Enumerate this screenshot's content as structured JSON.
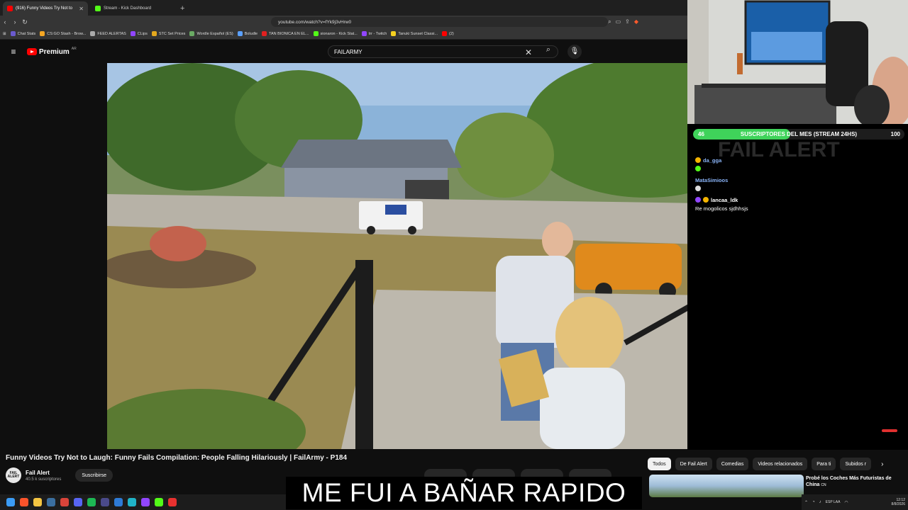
{
  "browser": {
    "tabs": [
      {
        "label": "(916) Funny Videos Try Not to",
        "active": true,
        "color": "#ff0000"
      },
      {
        "label": "Stream - Kick Dashboard",
        "active": false,
        "color": "#53fc18"
      }
    ],
    "new_tab": "+",
    "url": "youtube.com/watch?v=fYk9j3vHrw0",
    "bookmarks": [
      {
        "label": "Chat Stats",
        "color": "#6a5acd"
      },
      {
        "label": "CS:GO Stash - Brow...",
        "color": "#f5a623"
      },
      {
        "label": "FEED ALERTAS",
        "color": "#aaaaaa"
      },
      {
        "label": "CLips",
        "color": "#9146ff"
      },
      {
        "label": "STC Set Prices",
        "color": "#e4a81e"
      },
      {
        "label": "Wordle Español (ES)",
        "color": "#6aaa64"
      },
      {
        "label": "Boludle",
        "color": "#5aa0ff"
      },
      {
        "label": "TAN BIONICA EN EL...",
        "color": "#e02020"
      },
      {
        "label": "sionaron - Kick Stat...",
        "color": "#53fc18"
      },
      {
        "label": "trr - Twitch",
        "color": "#9146ff"
      },
      {
        "label": "Tanuki Sunset Classi...",
        "color": "#f5d020"
      },
      {
        "label": "(2)",
        "color": "#ff0000"
      }
    ]
  },
  "youtube": {
    "logo": "Premium",
    "region": "AR",
    "search_value": "FAILARMY",
    "video_title": "Funny Videos Try Not to Laugh: Funny Fails Compilation: People Falling Hilariously | FailArmy - P184",
    "channel_name": "Fail Alert",
    "channel_avatar": "FAIL ALERT",
    "subscribers": "40.5 k suscriptores",
    "subscribe_label": "Suscribirse",
    "chips": [
      "Todos",
      "De Fail Alert",
      "Comedias",
      "Videos relacionados",
      "Para ti",
      "Subidos r"
    ],
    "related_title": "Probé los Coches Más Futuristas de China",
    "related_suffix": "CN"
  },
  "caption": "ME FUI A BAÑAR RAPIDO",
  "stream_overlay": {
    "goal_current": "46",
    "goal_label": "SUSCRIPTORES DEL MES (STREAM 24HS)",
    "goal_target": "100",
    "goal_fraction": 0.46,
    "watermark": "FAIL ALERT",
    "chat": [
      {
        "user": "da_gga",
        "text": "",
        "color": "#8ab4f8"
      },
      {
        "user": "MataSimioos",
        "text": "",
        "color": "#8ab4f8"
      },
      {
        "user": "lancaa_ldk",
        "text": "Re mogolicos sjdhhsjs",
        "color": "#ffffff"
      }
    ]
  },
  "taskbar": {
    "lang": "ESP LAA",
    "time": "12:12",
    "date": "8/8/2026"
  }
}
